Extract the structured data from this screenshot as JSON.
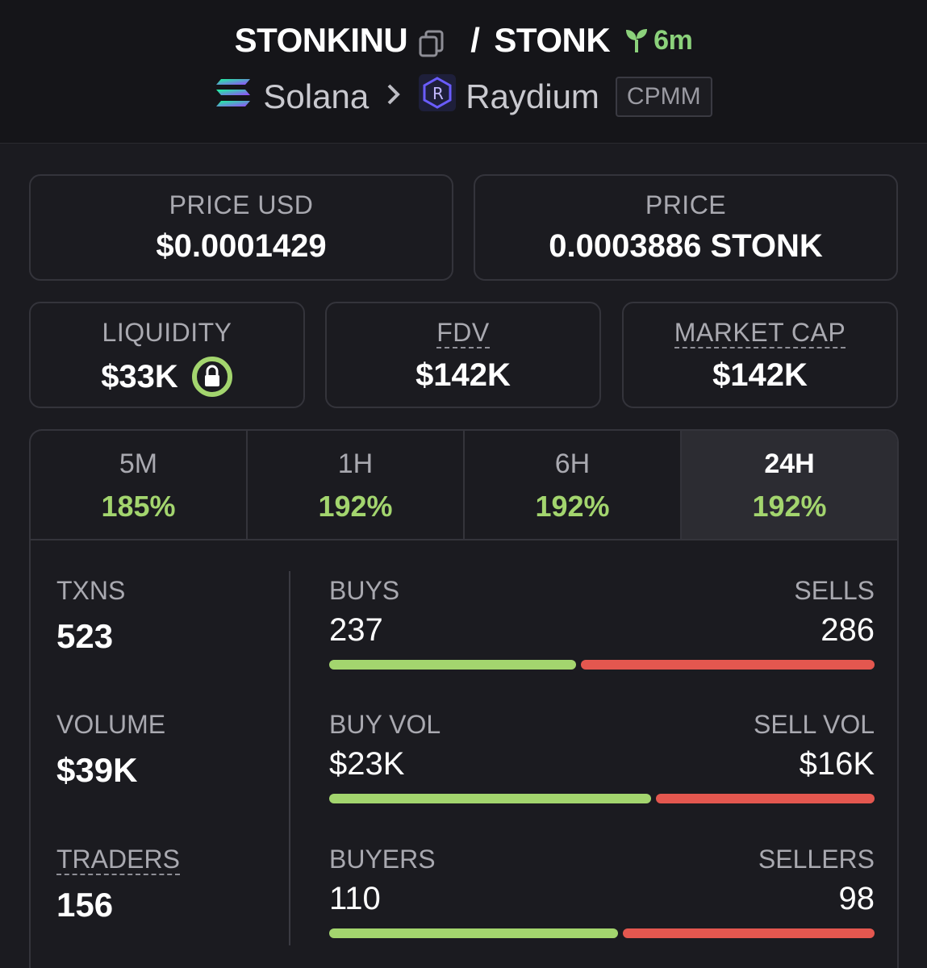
{
  "header": {
    "token_name": "STONKINU",
    "separator": "/",
    "quote_symbol": "STONK",
    "age": "6m",
    "chain": "Solana",
    "dex": "Raydium",
    "pool_type": "CPMM"
  },
  "price_usd": {
    "label": "PRICE USD",
    "value": "$0.0001429"
  },
  "price": {
    "label": "PRICE",
    "value": "0.0003886 STONK"
  },
  "liquidity": {
    "label": "LIQUIDITY",
    "value": "$33K"
  },
  "fdv": {
    "label": "FDV",
    "value": "$142K"
  },
  "market_cap": {
    "label": "MARKET CAP",
    "value": "$142K"
  },
  "timeframes": [
    {
      "label": "5M",
      "change": "185%"
    },
    {
      "label": "1H",
      "change": "192%"
    },
    {
      "label": "6H",
      "change": "192%"
    },
    {
      "label": "24H",
      "change": "192%"
    }
  ],
  "active_timeframe": "24H",
  "stats": {
    "txns": {
      "label": "TXNS",
      "value": "523"
    },
    "volume": {
      "label": "VOLUME",
      "value": "$39K"
    },
    "traders": {
      "label": "TRADERS",
      "value": "156"
    },
    "buys": {
      "label": "BUYS",
      "value": "237",
      "share": 0.453
    },
    "sells": {
      "label": "SELLS",
      "value": "286"
    },
    "buy_vol": {
      "label": "BUY VOL",
      "value": "$23K",
      "share": 0.59
    },
    "sell_vol": {
      "label": "SELL VOL",
      "value": "$16K"
    },
    "buyers": {
      "label": "BUYERS",
      "value": "110",
      "share": 0.529
    },
    "sellers": {
      "label": "SELLERS",
      "value": "98"
    }
  },
  "colors": {
    "positive": "#a3d56e",
    "negative": "#e4574f",
    "age": "#8bd17b"
  }
}
